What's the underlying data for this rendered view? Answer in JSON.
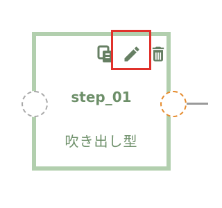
{
  "node": {
    "title": "step_01",
    "subtitle": "吹き出し型"
  },
  "toolbar": {
    "icons": [
      "copy-icon",
      "edit-icon",
      "delete-icon"
    ]
  },
  "colors": {
    "node_border": "#b2cfae",
    "text": "#6d8f69",
    "icon": "#667f63",
    "highlight": "#e0312b",
    "port_left": "#a8a8a8",
    "port_right": "#e58a2b",
    "connector": "#9a9a9a"
  }
}
